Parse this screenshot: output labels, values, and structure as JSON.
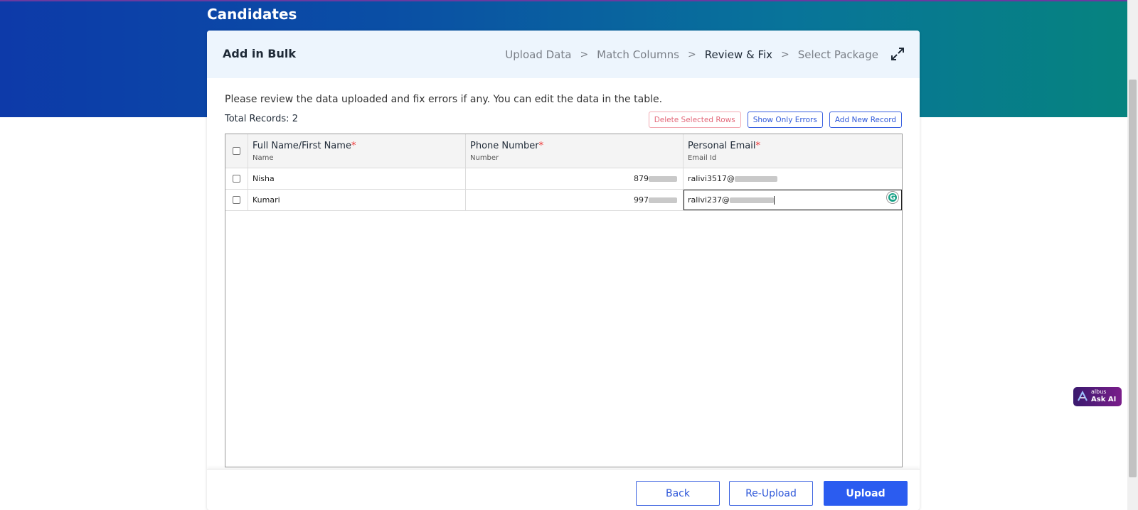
{
  "page": {
    "title": "Candidates"
  },
  "card": {
    "title": "Add in Bulk",
    "steps": [
      {
        "label": "Upload Data",
        "active": false
      },
      {
        "label": "Match Columns",
        "active": false
      },
      {
        "label": "Review & Fix",
        "active": true
      },
      {
        "label": "Select Package",
        "active": false
      }
    ],
    "step_separator": ">",
    "expand_icon": "expand-arrows-icon"
  },
  "review": {
    "instructions": "Please review the data uploaded and fix errors if any. You can edit the data in the table.",
    "total_records_label": "Total Records:",
    "total_records": "2",
    "buttons": {
      "delete_selected": "Delete Selected Rows",
      "show_only_errors": "Show Only Errors",
      "add_new_record": "Add New Record"
    }
  },
  "table": {
    "columns": [
      {
        "title": "Full Name/First Name",
        "required_mark": "*",
        "subtitle": "Name"
      },
      {
        "title": "Phone Number",
        "required_mark": "*",
        "subtitle": "Number"
      },
      {
        "title": "Personal Email",
        "required_mark": "*",
        "subtitle": "Email Id"
      }
    ],
    "rows": [
      {
        "name": "Nisha",
        "phone_visible": "879",
        "email_visible": "ralivi3517@"
      },
      {
        "name": "Kumari",
        "phone_visible": "997",
        "email_visible": "ralivi237@"
      }
    ]
  },
  "footer": {
    "back": "Back",
    "reupload": "Re-Upload",
    "upload": "Upload"
  },
  "assistant": {
    "brand": "albus",
    "label": "Ask AI"
  },
  "colors": {
    "accent": "#2b5cf0",
    "danger": "#e3697a",
    "banner_start": "#0d3aa9",
    "banner_end": "#06837f"
  }
}
